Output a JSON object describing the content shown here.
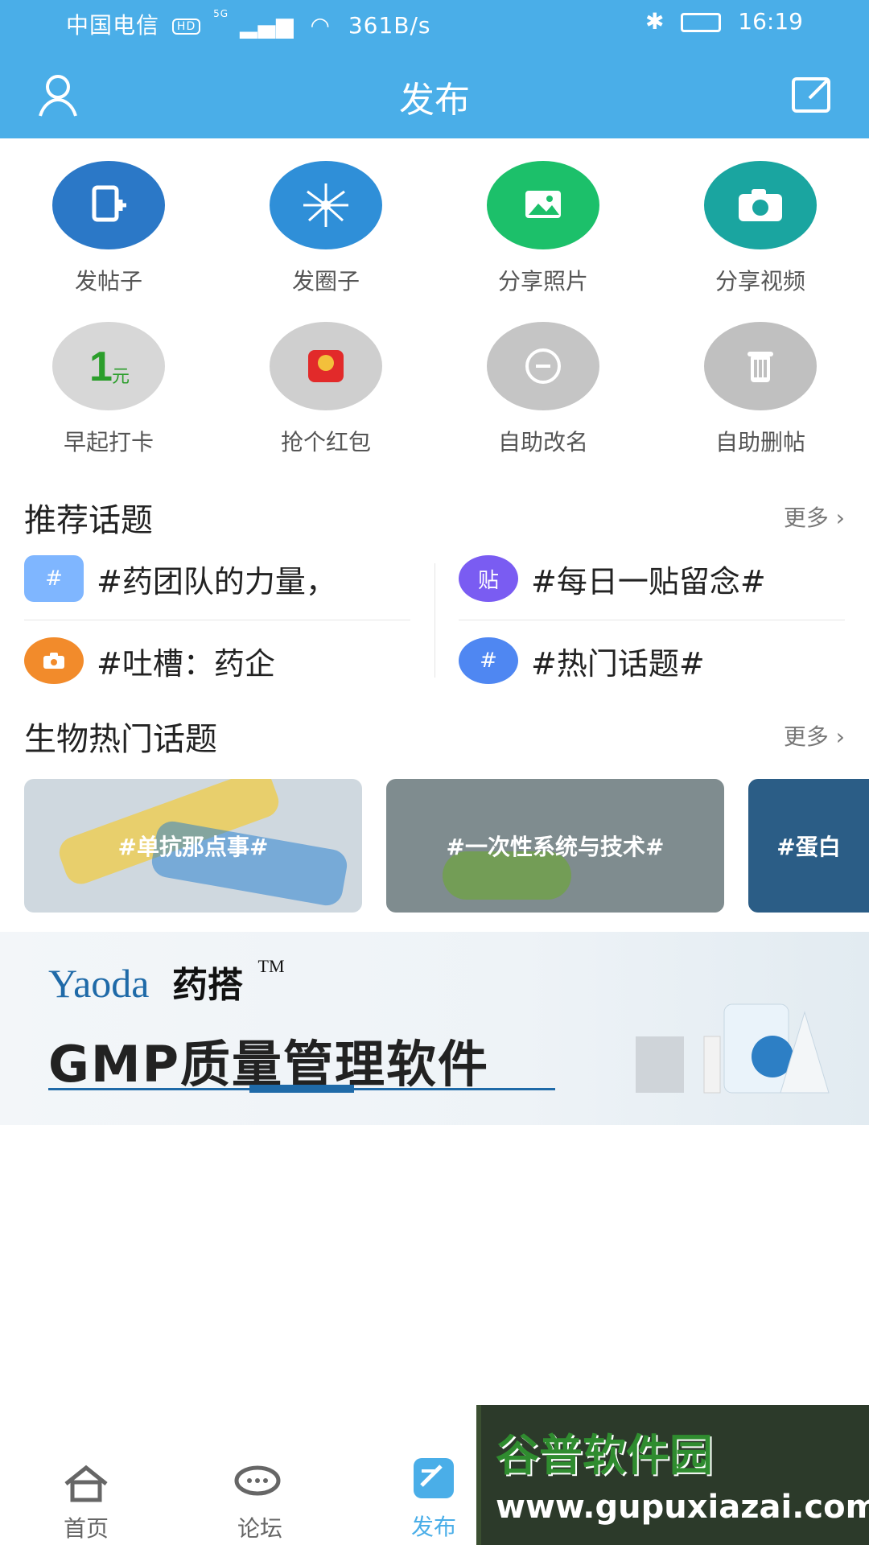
{
  "status": {
    "carrier": "中国电信",
    "hd": "HD",
    "net": "5G",
    "speed": "361B/s",
    "time": "16:19"
  },
  "appbar": {
    "title": "发布",
    "left_icon": "user-icon",
    "right_icon": "edit-icon"
  },
  "grid": {
    "items": [
      {
        "label": "发帖子",
        "icon": "post-add-icon",
        "color": "#2b78c7"
      },
      {
        "label": "发圈子",
        "icon": "burst-icon",
        "color": "#2f8fd8"
      },
      {
        "label": "分享照片",
        "icon": "image-icon",
        "color": "#1cc06a"
      },
      {
        "label": "分享视频",
        "icon": "camera-icon",
        "color": "#1aa5a0"
      },
      {
        "label": "早起打卡",
        "icon": "one-yuan-icon",
        "color": "#d7d7d7"
      },
      {
        "label": "抢个红包",
        "icon": "red-envelope-icon",
        "color": "#cfcfcf"
      },
      {
        "label": "自助改名",
        "icon": "rename-icon",
        "color": "#c5c5c5"
      },
      {
        "label": "自助删帖",
        "icon": "trash-icon",
        "color": "#c0c0c0"
      }
    ]
  },
  "recommended": {
    "title": "推荐话题",
    "more": "更多",
    "items": [
      {
        "text": "#药团队的力量，",
        "badge": "#",
        "icon": "hashtag-chat-icon",
        "color": "#7fb6ff"
      },
      {
        "text": "#每日一贴留念#",
        "badge": "贴",
        "icon": "post-badge-icon",
        "color": "#7a5cf2"
      },
      {
        "text": "#吐槽：药企",
        "badge": "",
        "icon": "camera-badge-icon",
        "color": "#f28b2b"
      },
      {
        "text": "#热门话题#",
        "badge": "#",
        "icon": "hashtag-bubble-icon",
        "color": "#4f87f2"
      }
    ]
  },
  "bio_hot": {
    "title": "生物热门话题",
    "more": "更多",
    "cards": [
      {
        "text": "#单抗那点事#",
        "bg": "#cfd8df"
      },
      {
        "text": "#一次性系统与技术#",
        "bg": "#7f8c8f"
      },
      {
        "text": "#蛋白",
        "bg": "#2b5d86"
      }
    ]
  },
  "banner": {
    "brand": "Yaoda",
    "brand_cn": "药搭",
    "tm": "TM",
    "headline": "GMP质量管理软件"
  },
  "tabbar": {
    "tabs": [
      {
        "label": "首页",
        "icon": "home-icon"
      },
      {
        "label": "论坛",
        "icon": "forum-icon"
      },
      {
        "label": "发布",
        "icon": "publish-icon",
        "active": true
      }
    ]
  },
  "watermark": {
    "line1": "谷普软件园",
    "line2": "www.gupuxiazai.com"
  }
}
